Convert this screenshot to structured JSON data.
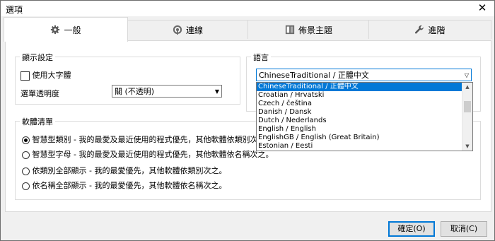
{
  "window": {
    "title": "選項",
    "close_glyph": "✕"
  },
  "tabs": [
    {
      "label": "一般",
      "icon": "gear-icon"
    },
    {
      "label": "連線",
      "icon": "signal-icon"
    },
    {
      "label": "佈景主題",
      "icon": "theme-icon"
    },
    {
      "label": "進階",
      "icon": "wrench-icon"
    }
  ],
  "display": {
    "group_title": "顯示設定",
    "large_font_label": "使用大字體",
    "large_font_checked": false,
    "opacity_label": "選單透明度",
    "opacity_value": "關 (不透明)"
  },
  "language": {
    "group_title": "語言",
    "selected": "ChineseTraditional / 正體中文",
    "options": [
      "ChineseTraditional / 正體中文",
      "Croatian / Hrvatski",
      "Czech / čeština",
      "Danish / Dansk",
      "Dutch / Nederlands",
      "English / English",
      "EnglishGB / English (Great Britain)",
      "Estonian / Eesti"
    ]
  },
  "software_list": {
    "group_title": "軟體清單",
    "options": [
      {
        "label": "智慧型類別 - 我的最愛及最近使用的程式優先，其他軟體依類別次",
        "selected": true
      },
      {
        "label": "智慧型字母 - 我的最愛及最近使用的程式優先，其他軟體依名稱次之。",
        "selected": false
      },
      {
        "label": "依類別全部顯示 - 我的最愛優先，其他軟體依類別次之。",
        "selected": false
      },
      {
        "label": "依名稱全部顯示 - 我的最愛優先，其他軟體依名稱次之。",
        "selected": false
      }
    ]
  },
  "buttons": {
    "ok": "確定(O)",
    "cancel": "取消(C)"
  },
  "colors": {
    "accent": "#0078d7",
    "dialog_bg": "#f0f0f0",
    "panel_bg": "#ffffff"
  }
}
